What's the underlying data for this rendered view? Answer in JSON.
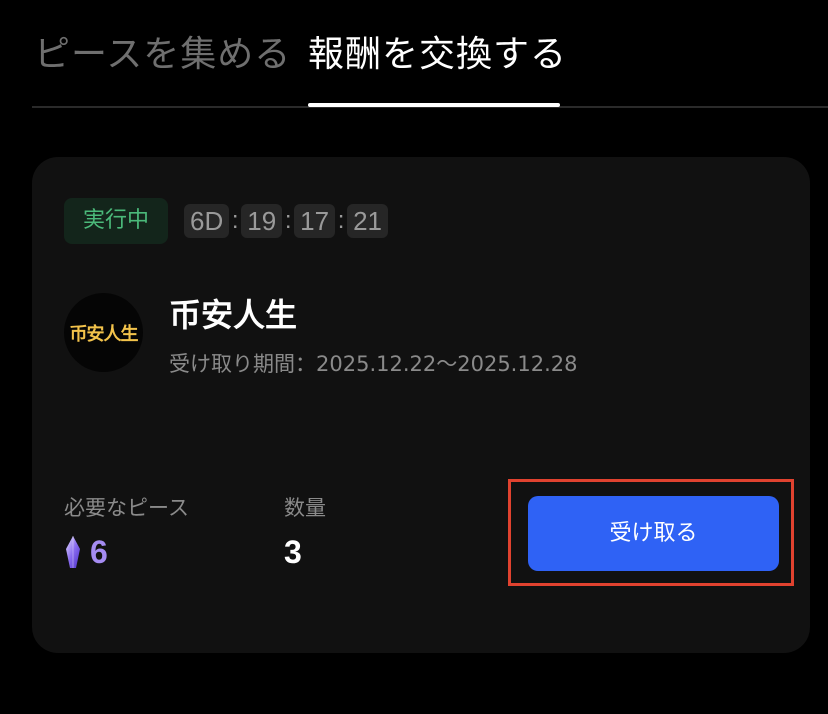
{
  "tabs": [
    {
      "label": "ピースを集める",
      "active": false
    },
    {
      "label": "報酬を交換する",
      "active": true
    }
  ],
  "reward": {
    "status": "実行中",
    "timer": {
      "days": "6D",
      "hours": "19",
      "minutes": "17",
      "seconds": "21",
      "separator": ":"
    },
    "avatar_text": "币安人生",
    "title": "币安人生",
    "period": "受け取り期間：2025.12.22〜2025.12.28",
    "required_label": "必要なピース",
    "required_value": "6",
    "quantity_label": "数量",
    "quantity_value": "3",
    "button_label": "受け取る"
  },
  "colors": {
    "background": "#000000",
    "card": "#111111",
    "status_green": "#4bb97a",
    "accent_blue": "#2f62f5",
    "piece_purple": "#a58cf2",
    "highlight_red": "#e0422f",
    "avatar_gold": "#f3c34b"
  },
  "icons": {
    "piece": "crystal-icon"
  }
}
